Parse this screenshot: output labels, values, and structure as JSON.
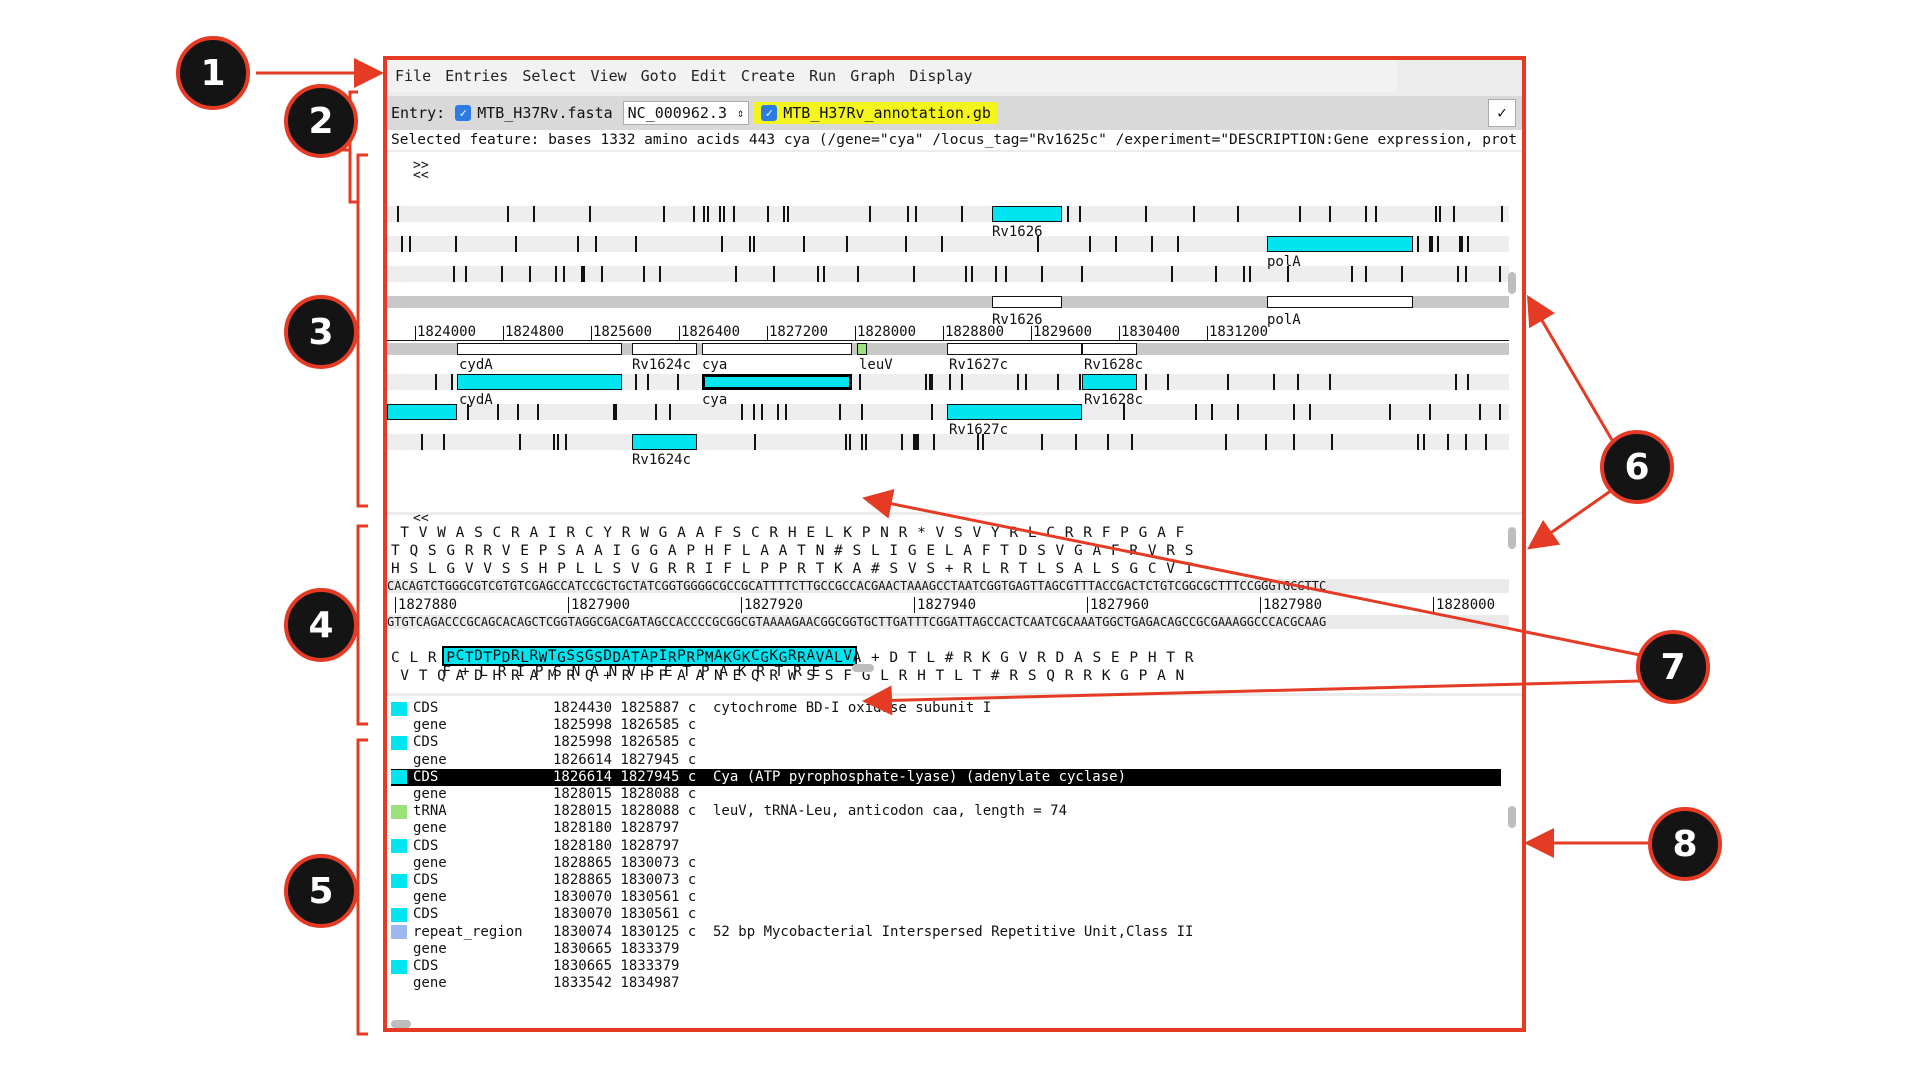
{
  "callouts": [
    "1",
    "2",
    "3",
    "4",
    "5",
    "6",
    "7",
    "8"
  ],
  "menu": [
    "File",
    "Entries",
    "Select",
    "View",
    "Goto",
    "Edit",
    "Create",
    "Run",
    "Graph",
    "Display"
  ],
  "entry": {
    "label": "Entry:",
    "fasta": "MTB_H37Rv.fasta",
    "sequence_select": "NC_000962.3",
    "annotation": "MTB_H37Rv_annotation.gb",
    "ok": "✓"
  },
  "selected_feature": "Selected feature:  bases 1332  amino acids 443  cya  (/gene=\"cya\" /locus_tag=\"Rv1625c\" /experiment=\"DESCRIPTION:Gene expression, prot",
  "feature_view": {
    "scroll_right": ">>",
    "scroll_left": "<<",
    "ruler_ticks": [
      "1824000",
      "1824800",
      "1825600",
      "1826400",
      "1827200",
      "1828000",
      "1828800",
      "1829600",
      "1830400",
      "1831200"
    ],
    "labels": {
      "rv1626_top": "Rv1626",
      "polA_top": "polA",
      "rv1626_mid": "Rv1626",
      "polA_mid": "polA",
      "cydA_1": "cydA",
      "rv1624c_1": "Rv1624c",
      "cya_1": "cya",
      "leuV": "leuV",
      "rv1627c_1": "Rv1627c",
      "rv1628c_1": "Rv1628c",
      "cydA_2": "cydA",
      "cya_2": "cya",
      "rv1628c_2": "Rv1628c",
      "rv1627c_2": "Rv1627c",
      "rv1624c_2": "Rv1624c"
    }
  },
  "sequence_view": {
    "scroll_left": "<<",
    "frames_fwd": [
      " T V W A S C R A I R C Y R W G A A F S C R H E L K P N R * V S V Y R L C R R F P G A F",
      "T Q S G R R V E P S A A I G G A P H F L A A T N # S L I G E L A F T D S V G A F R V R S",
      "H S L G V V S S H P L L S V G R R I F L P P R T K A # S V S + R L R T L S A L S G C V I"
    ],
    "dna_fwd": "CACAGTCTGGGCGTCGTGTCGAGCCATCCGCTGCTATCGGTGGGGCGCCGCATTTTCTTGCCGCCACGAACTAAAGCCTAATCGGTGAGTTAGCGTTTACCGACTCTGTCGGCGCTTTCCGGGTGCGTTC",
    "positions": [
      "1827880",
      "1827900",
      "1827920",
      "1827940",
      "1827960",
      "1827980",
      "1828000"
    ],
    "dna_rev": "GTGTCAGACCCGCAGCACAGCTCGGTAGGCGACGATAGCCACCCCGCGGCGTAAAAGAACGGCGGTGCTTGATTTCGGATTAGCCACTCAATCGCAAATGGCTGAGACAGCCGCGAAAGGCCCACGCAAG",
    "cya_aa": " C D P R R T S G D A A I P P A G C K R A A V",
    "rev_frame1_rest": "F + L R I P S N A N V S E T P A K R T R E",
    "rev_frame2": "C L R P T T D L W G S S D T P R R M K K G G R V L A + D T L # R K G V R D A S E P H T R",
    "rev_frame3": " V T Q A D H R A M R Q + R H P A A N E Q R W S S F G L R H T L T # R S Q R R K G P A N"
  },
  "feature_list": {
    "rows": [
      {
        "key": "CDS",
        "loc": "1824430 1825887 c",
        "note": "cytochrome BD-I oxidase subunit I",
        "color": "#00e5f0"
      },
      {
        "key": "gene",
        "loc": "1825998 1826585 c",
        "note": "",
        "color": ""
      },
      {
        "key": "CDS",
        "loc": "1825998 1826585 c",
        "note": "",
        "color": "#00e5f0"
      },
      {
        "key": "gene",
        "loc": "1826614 1827945 c",
        "note": "",
        "color": ""
      },
      {
        "key": "CDS",
        "loc": "1826614 1827945 c",
        "note": "Cya (ATP pyrophosphate-lyase) (adenylate cyclase)",
        "color": "#00e5f0",
        "selected": true
      },
      {
        "key": "gene",
        "loc": "1828015 1828088 c",
        "note": "",
        "color": ""
      },
      {
        "key": "tRNA",
        "loc": "1828015 1828088 c",
        "note": "leuV, tRNA-Leu, anticodon caa, length = 74",
        "color": "#9be27a"
      },
      {
        "key": "gene",
        "loc": "1828180 1828797",
        "note": "",
        "color": ""
      },
      {
        "key": "CDS",
        "loc": "1828180 1828797",
        "note": "",
        "color": "#00e5f0"
      },
      {
        "key": "gene",
        "loc": "1828865 1830073 c",
        "note": "",
        "color": ""
      },
      {
        "key": "CDS",
        "loc": "1828865 1830073 c",
        "note": "",
        "color": "#00e5f0"
      },
      {
        "key": "gene",
        "loc": "1830070 1830561 c",
        "note": "",
        "color": ""
      },
      {
        "key": "CDS",
        "loc": "1830070 1830561 c",
        "note": "",
        "color": "#00e5f0"
      },
      {
        "key": "repeat_region",
        "loc": "1830074 1830125 c",
        "note": "52 bp Mycobacterial Interspersed Repetitive Unit,Class II",
        "color": "#9fb7ef"
      },
      {
        "key": "gene",
        "loc": "1830665 1833379",
        "note": "",
        "color": ""
      },
      {
        "key": "CDS",
        "loc": "1830665 1833379",
        "note": "",
        "color": "#00e5f0"
      },
      {
        "key": "gene",
        "loc": "1833542 1834987",
        "note": "",
        "color": ""
      }
    ]
  }
}
